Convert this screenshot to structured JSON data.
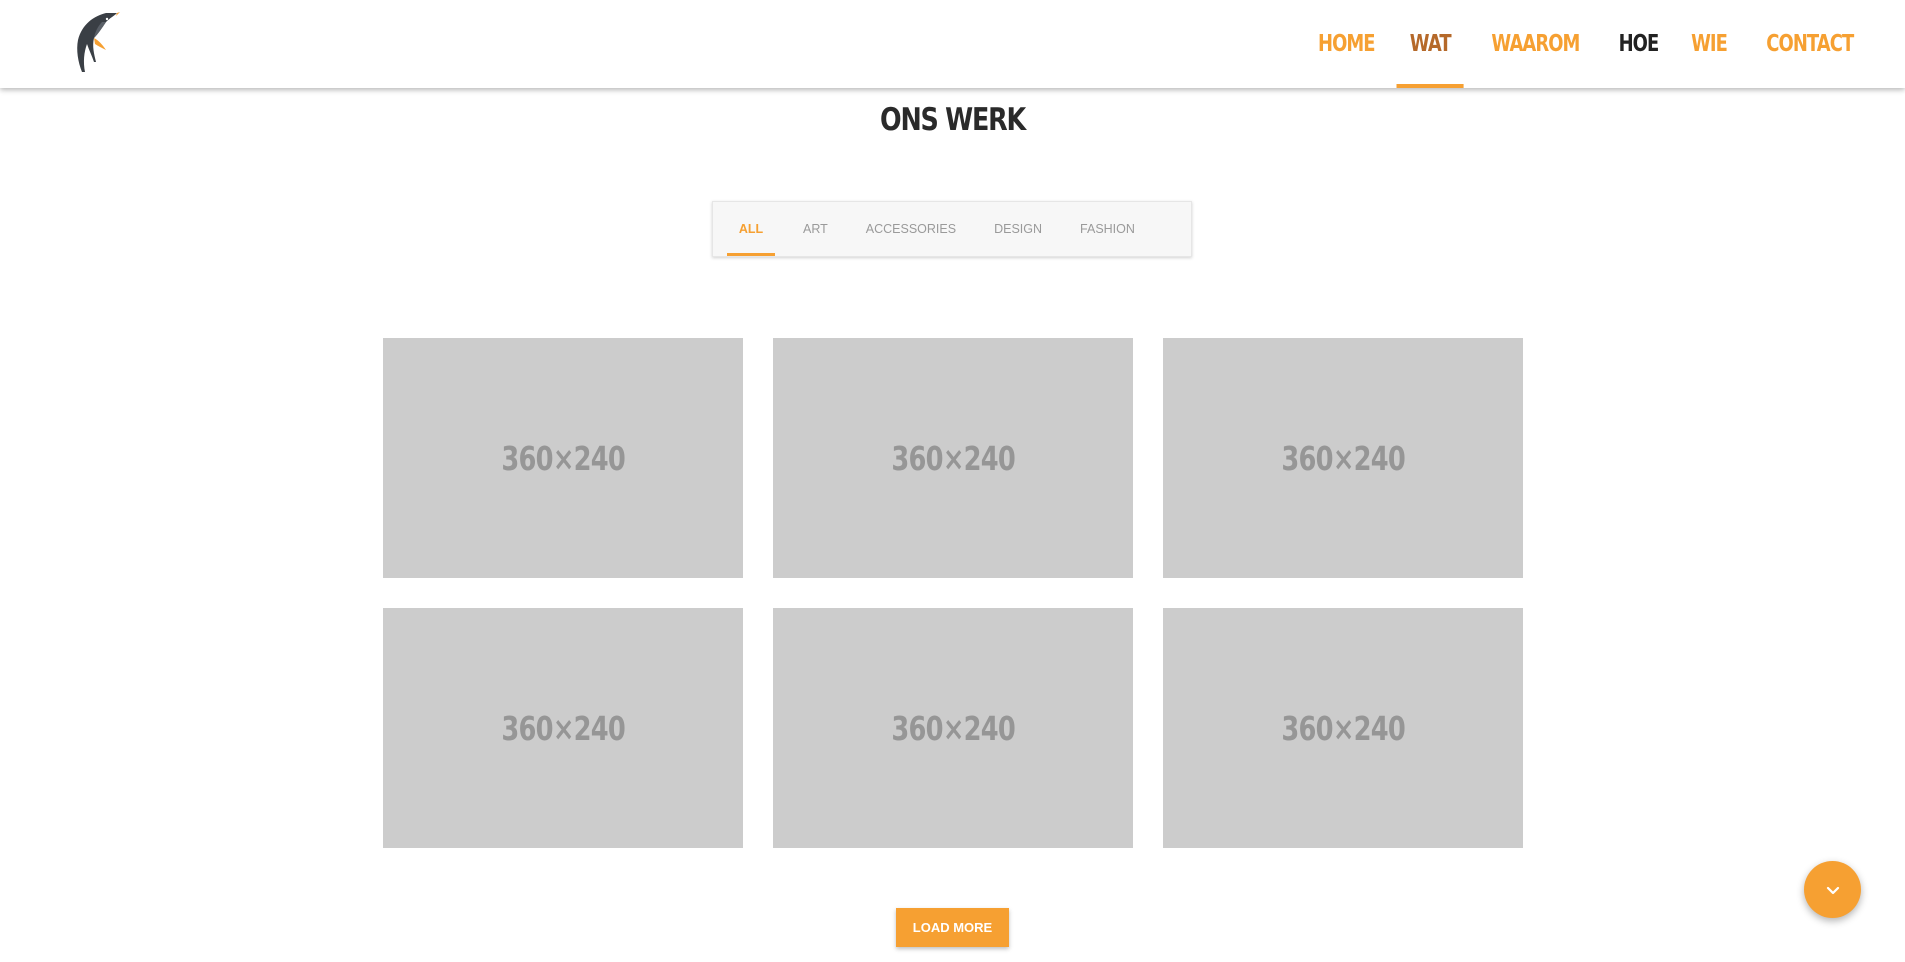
{
  "header": {
    "nav": [
      {
        "label": "HOME",
        "state": "normal"
      },
      {
        "label": "WAT",
        "state": "active"
      },
      {
        "label": "WAAROM",
        "state": "normal"
      },
      {
        "label": "HOE",
        "state": "dark"
      },
      {
        "label": "WIE",
        "state": "normal"
      },
      {
        "label": "CONTACT",
        "state": "normal"
      }
    ]
  },
  "section": {
    "title": "ONS WERK"
  },
  "filters": {
    "tabs": [
      "ALL",
      "ART",
      "ACCESSORIES",
      "DESIGN",
      "FASHION"
    ],
    "active": "ALL"
  },
  "portfolio": {
    "items": [
      {
        "placeholder": "360×240"
      },
      {
        "placeholder": "360×240"
      },
      {
        "placeholder": "360×240"
      },
      {
        "placeholder": "360×240"
      },
      {
        "placeholder": "360×240"
      },
      {
        "placeholder": "360×240"
      }
    ]
  },
  "actions": {
    "load_more_label": "LOAD MORE",
    "fab_icon": "chevron-down-icon"
  },
  "colors": {
    "accent": "#f6a032",
    "active_nav": "#b5692a",
    "placeholder_bg": "#cccccc",
    "placeholder_text": "#969696",
    "title": "#2a2a2a"
  }
}
